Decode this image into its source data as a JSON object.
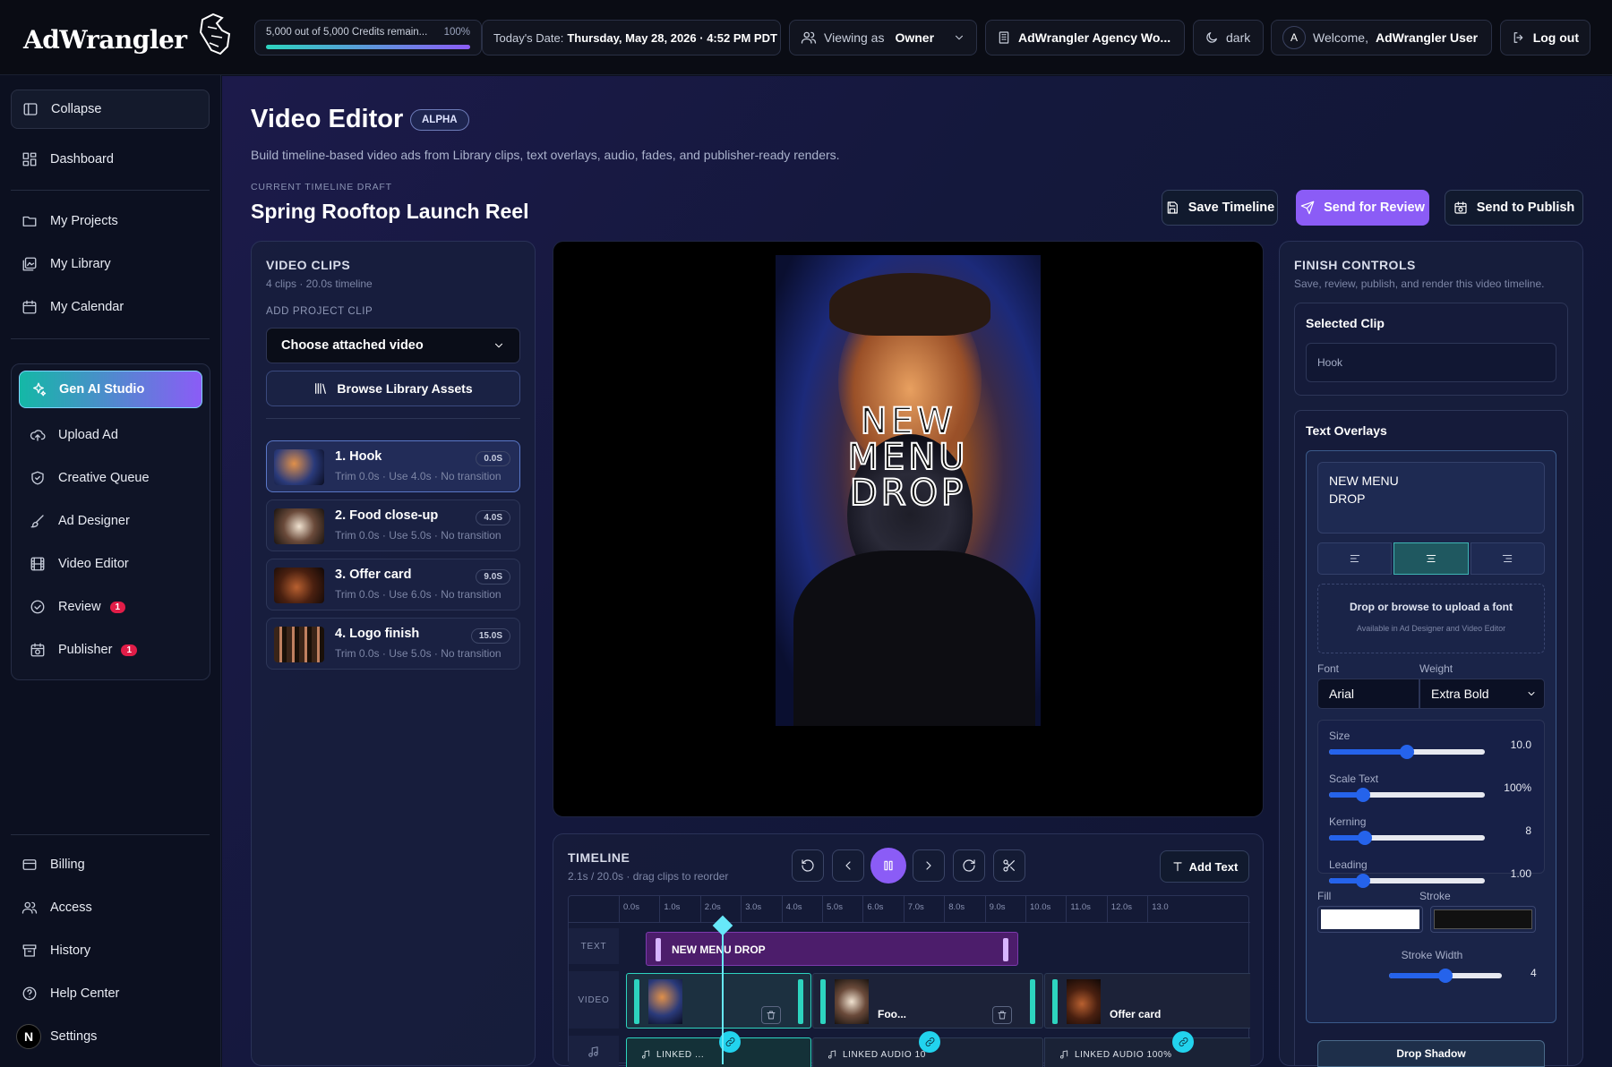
{
  "topbar": {
    "brand": "AdWrangler",
    "credits_text": "5,000 out of 5,000 Credits remain...",
    "credits_pct": "100%",
    "credits_fraction": 1.0,
    "date_label": "Today's Date:",
    "date_value": "Thursday, May 28, 2026 · 4:52 PM PDT",
    "viewing_label": "Viewing as",
    "viewing_value": "Owner",
    "workspace": "AdWrangler Agency Wo...",
    "theme": "dark",
    "avatar_initial": "A",
    "welcome_label": "Welcome,",
    "welcome_user": "AdWrangler User",
    "logout": "Log out"
  },
  "sidebar": {
    "collapse": "Collapse",
    "dashboard": "Dashboard",
    "group1": [
      "My Projects",
      "My Library",
      "My Calendar"
    ],
    "studio": "Gen AI Studio",
    "group2": [
      "Upload Ad",
      "Creative Queue",
      "Ad Designer",
      "Video Editor"
    ],
    "review": "Review",
    "review_badge": "1",
    "publisher": "Publisher",
    "publisher_badge": "1",
    "bottom": [
      "Billing",
      "Access",
      "History",
      "Help Center",
      "Settings"
    ],
    "settings_avatar": "N"
  },
  "header": {
    "title": "Video Editor",
    "tag": "ALPHA",
    "subtitle": "Build timeline-based video ads from Library clips, text overlays, audio, fades, and publisher-ready renders.",
    "draft_label": "CURRENT TIMELINE DRAFT",
    "draft_name": "Spring Rooftop Launch Reel",
    "save": "Save Timeline",
    "review": "Send for Review",
    "publish": "Send to Publish"
  },
  "clips_panel": {
    "title": "VIDEO CLIPS",
    "meta": "4 clips · 20.0s timeline",
    "add_label": "ADD PROJECT CLIP",
    "select_value": "Choose attached video",
    "browse": "Browse Library Assets",
    "clips": [
      {
        "title": "1. Hook",
        "meta": "Trim 0.0s · Use 4.0s · No transition",
        "chip": "0.0S"
      },
      {
        "title": "2. Food close-up",
        "meta": "Trim 0.0s · Use 5.0s · No transition",
        "chip": "4.0S"
      },
      {
        "title": "3. Offer card",
        "meta": "Trim 0.0s · Use 6.0s · No transition",
        "chip": "9.0S"
      },
      {
        "title": "4. Logo finish",
        "meta": "Trim 0.0s · Use 5.0s · No transition",
        "chip": "15.0S"
      }
    ]
  },
  "preview": {
    "overlay_lines": [
      "NEW",
      "MENU",
      "DROP"
    ]
  },
  "timeline": {
    "title": "TIMELINE",
    "meta": "2.1s / 20.0s · drag clips to reorder",
    "add_text": "Add Text",
    "ticks": [
      "0.0s",
      "1.0s",
      "2.0s",
      "3.0s",
      "4.0s",
      "5.0s",
      "6.0s",
      "7.0s",
      "8.0s",
      "9.0s",
      "10.0s",
      "11.0s",
      "12.0s",
      "13.0"
    ],
    "rows": {
      "text": "TEXT",
      "video": "VIDEO"
    },
    "text_clip": "NEW MENU DROP",
    "video_clips": [
      "",
      "Foo...",
      "Offer card"
    ],
    "audio_clips": [
      "LINKED ...",
      "LINKED AUDIO 10",
      "LINKED AUDIO 100%"
    ]
  },
  "finish": {
    "title": "FINISH CONTROLS",
    "meta": "Save, review, publish, and render this video timeline.",
    "selected_label": "Selected Clip",
    "selected_value": "Hook",
    "overlays_label": "Text Overlays",
    "overlay_text": "NEW MENU\nDROP",
    "font_drop": "Drop or browse to upload a font",
    "font_drop_sub": "Available in Ad Designer and Video Editor",
    "font_label": "Font",
    "font_value": "Arial",
    "weight_label": "Weight",
    "weight_value": "Extra Bold",
    "size_label": "Size",
    "size_value": "10.0",
    "size_level": 0.5,
    "scale_label": "Scale Text",
    "scale_value": "100%",
    "scale_level": 0.22,
    "kerning_label": "Kerning",
    "kerning_value": "8",
    "kerning_level": 0.23,
    "leading_label": "Leading",
    "leading_value": "1.00",
    "leading_level": 0.22,
    "fill_label": "Fill",
    "fill_color": "#ffffff",
    "stroke_label": "Stroke",
    "stroke_color": "#111111",
    "stroke_width_label": "Stroke Width",
    "stroke_width_value": "4",
    "stroke_width_level": 0.5,
    "drop_shadow": "Drop Shadow"
  },
  "colors": {
    "accent": "#8b5cf6",
    "teal": "#2dd4bf",
    "playhead": "#67e8f9"
  }
}
